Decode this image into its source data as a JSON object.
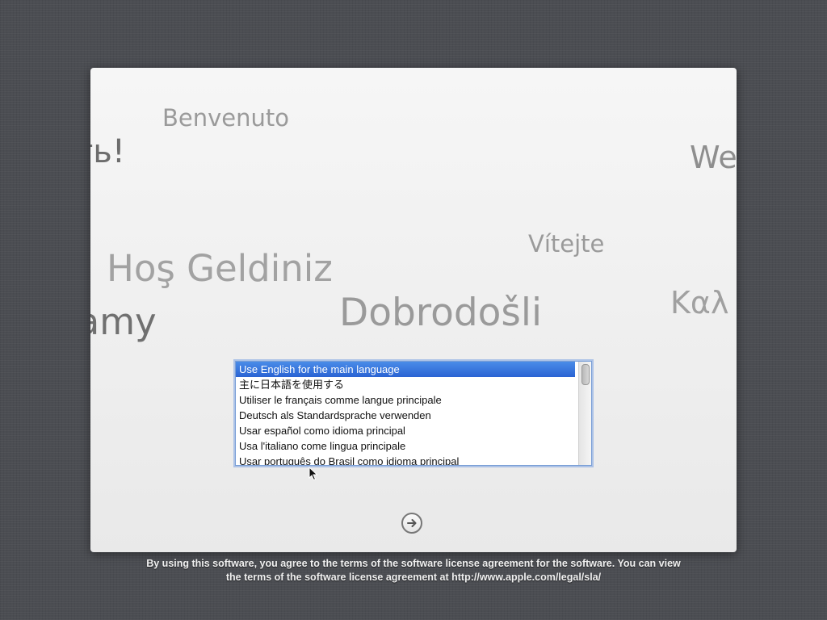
{
  "greetings": [
    "Benvenuto",
    "ть!",
    "We",
    "Vítejte",
    "Hoş Geldiniz",
    "tamy",
    "Dobrodošli",
    "Καλ"
  ],
  "language_list": {
    "selected_index": 0,
    "items": [
      "Use English for the main language",
      "主に日本語を使用する",
      "Utiliser le français comme langue principale",
      "Deutsch als Standardsprache verwenden",
      "Usar español como idioma principal",
      "Usa l'italiano come lingua principale",
      "Usar português do Brasil como idioma principal"
    ]
  },
  "continue_button": {
    "icon": "right-arrow-icon"
  },
  "license": {
    "line1": "By using this software, you agree to the terms of the software license agreement for the software. You can view",
    "line2": "the terms of the software license agreement at http://www.apple.com/legal/sla/"
  },
  "colors": {
    "background": "#4b4d52",
    "selection": "#3a78de",
    "panel": "#f0f0f0"
  }
}
